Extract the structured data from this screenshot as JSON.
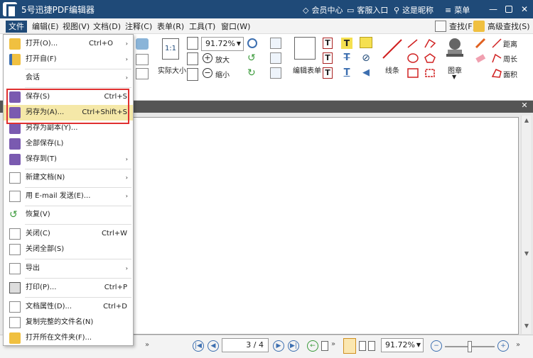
{
  "titlebar": {
    "title": "5号迅捷PDF编辑器",
    "member": "会员中心",
    "service": "客服入口",
    "nickname": "这是昵称",
    "menu": "菜单"
  },
  "menubar": {
    "items": [
      "文件",
      "编辑(E)",
      "视图(V)",
      "文档(D)",
      "注释(C)",
      "表单(R)",
      "工具(T)",
      "窗口(W)"
    ],
    "find": "查找(F)",
    "advanced_find": "高级查找(S)"
  },
  "ribbon": {
    "zoom_value": "91.72%",
    "actual_size": "实际大小",
    "zoom_in": "放大",
    "zoom_out": "缩小",
    "edit_form": "编辑表单",
    "line": "线条",
    "stamp": "图章",
    "distance": "距离",
    "perimeter": "周长",
    "area": "面积"
  },
  "file_menu": {
    "items": [
      {
        "label": "打开(O)...",
        "shortcut": "Ctrl+O",
        "arrow": "›"
      },
      {
        "label": "打开自(F)",
        "shortcut": "",
        "arrow": "›"
      },
      {
        "label": "会话",
        "shortcut": "",
        "arrow": "›"
      },
      {
        "label": "保存(S)",
        "shortcut": "Ctrl+S",
        "arrow": ""
      },
      {
        "label": "另存为(A)...",
        "shortcut": "Ctrl+Shift+S",
        "arrow": ""
      },
      {
        "label": "另存为副本(Y)...",
        "shortcut": "",
        "arrow": ""
      },
      {
        "label": "全部保存(L)",
        "shortcut": "",
        "arrow": ""
      },
      {
        "label": "保存到(T)",
        "shortcut": "",
        "arrow": "›"
      },
      {
        "label": "新建文档(N)",
        "shortcut": "",
        "arrow": "›"
      },
      {
        "label": "用 E-mail 发送(E)...",
        "shortcut": "",
        "arrow": "›"
      },
      {
        "label": "恢复(V)",
        "shortcut": "",
        "arrow": ""
      },
      {
        "label": "关闭(C)",
        "shortcut": "Ctrl+W",
        "arrow": ""
      },
      {
        "label": "关闭全部(S)",
        "shortcut": "",
        "arrow": ""
      },
      {
        "label": "导出",
        "shortcut": "",
        "arrow": "›"
      },
      {
        "label": "打印(P)...",
        "shortcut": "Ctrl+P",
        "arrow": ""
      },
      {
        "label": "文档属性(D)...",
        "shortcut": "Ctrl+D",
        "arrow": ""
      },
      {
        "label": "复制完整的文件名(N)",
        "shortcut": "",
        "arrow": ""
      },
      {
        "label": "打开所在文件夹(F)...",
        "shortcut": "",
        "arrow": ""
      }
    ]
  },
  "statusbar": {
    "page_indicator": "3 / 4",
    "zoom_value": "91.72%"
  },
  "colors": {
    "titlebar": "#1f4a78",
    "highlight_box": "#e03030",
    "selected_item": "#f5e8a8"
  }
}
